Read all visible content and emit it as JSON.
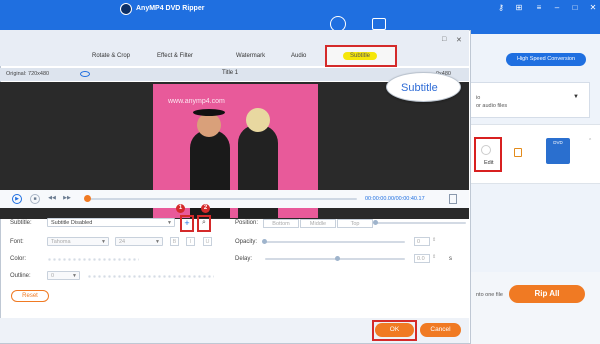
{
  "app": {
    "title": "AnyMP4 DVD Ripper",
    "high_speed_label": "High Speed Conversion",
    "source_hint": "io",
    "source_hint2": "or audio files",
    "edit_label": "Edit",
    "dvd_label": "DVD",
    "merge_label": "nto one file",
    "rip_all_label": "Rip All",
    "colors": {
      "header": "#1f6fe0",
      "accent": "#f07a23",
      "highlight_box": "#d42a2a"
    }
  },
  "modal": {
    "tabs": [
      "Rotate & Crop",
      "Effect & Filter",
      "Watermark",
      "Audio",
      "Subtitle"
    ],
    "active_tab": "Subtitle",
    "callout": "Subtitle",
    "original_label": "Original: 720x480",
    "output_label": "0x480",
    "title_label": "Title 1",
    "watermark_text": "www.anymp4.com",
    "time_display": "00:00:00.00/00:00:40.17",
    "progress": 0.0,
    "controls": {
      "subtitle_label": "Subtitle:",
      "subtitle_value": "Subtitle Disabled",
      "font_label": "Font:",
      "font_value": "Tahoma",
      "font_size": "24",
      "bold": "B",
      "italic": "I",
      "underline": "U",
      "color_label": "Color:",
      "outline_label": "Outline:",
      "outline_value": "0",
      "position_label": "Position:",
      "positions": [
        "Bottom",
        "Middle",
        "Top"
      ],
      "opacity_label": "Opacity:",
      "opacity_value": "0",
      "delay_label": "Delay:",
      "delay_value": "0.0",
      "delay_unit": "s",
      "reset_label": "Reset"
    },
    "badges": [
      "1",
      "2"
    ],
    "ok_label": "OK",
    "cancel_label": "Cancel"
  }
}
